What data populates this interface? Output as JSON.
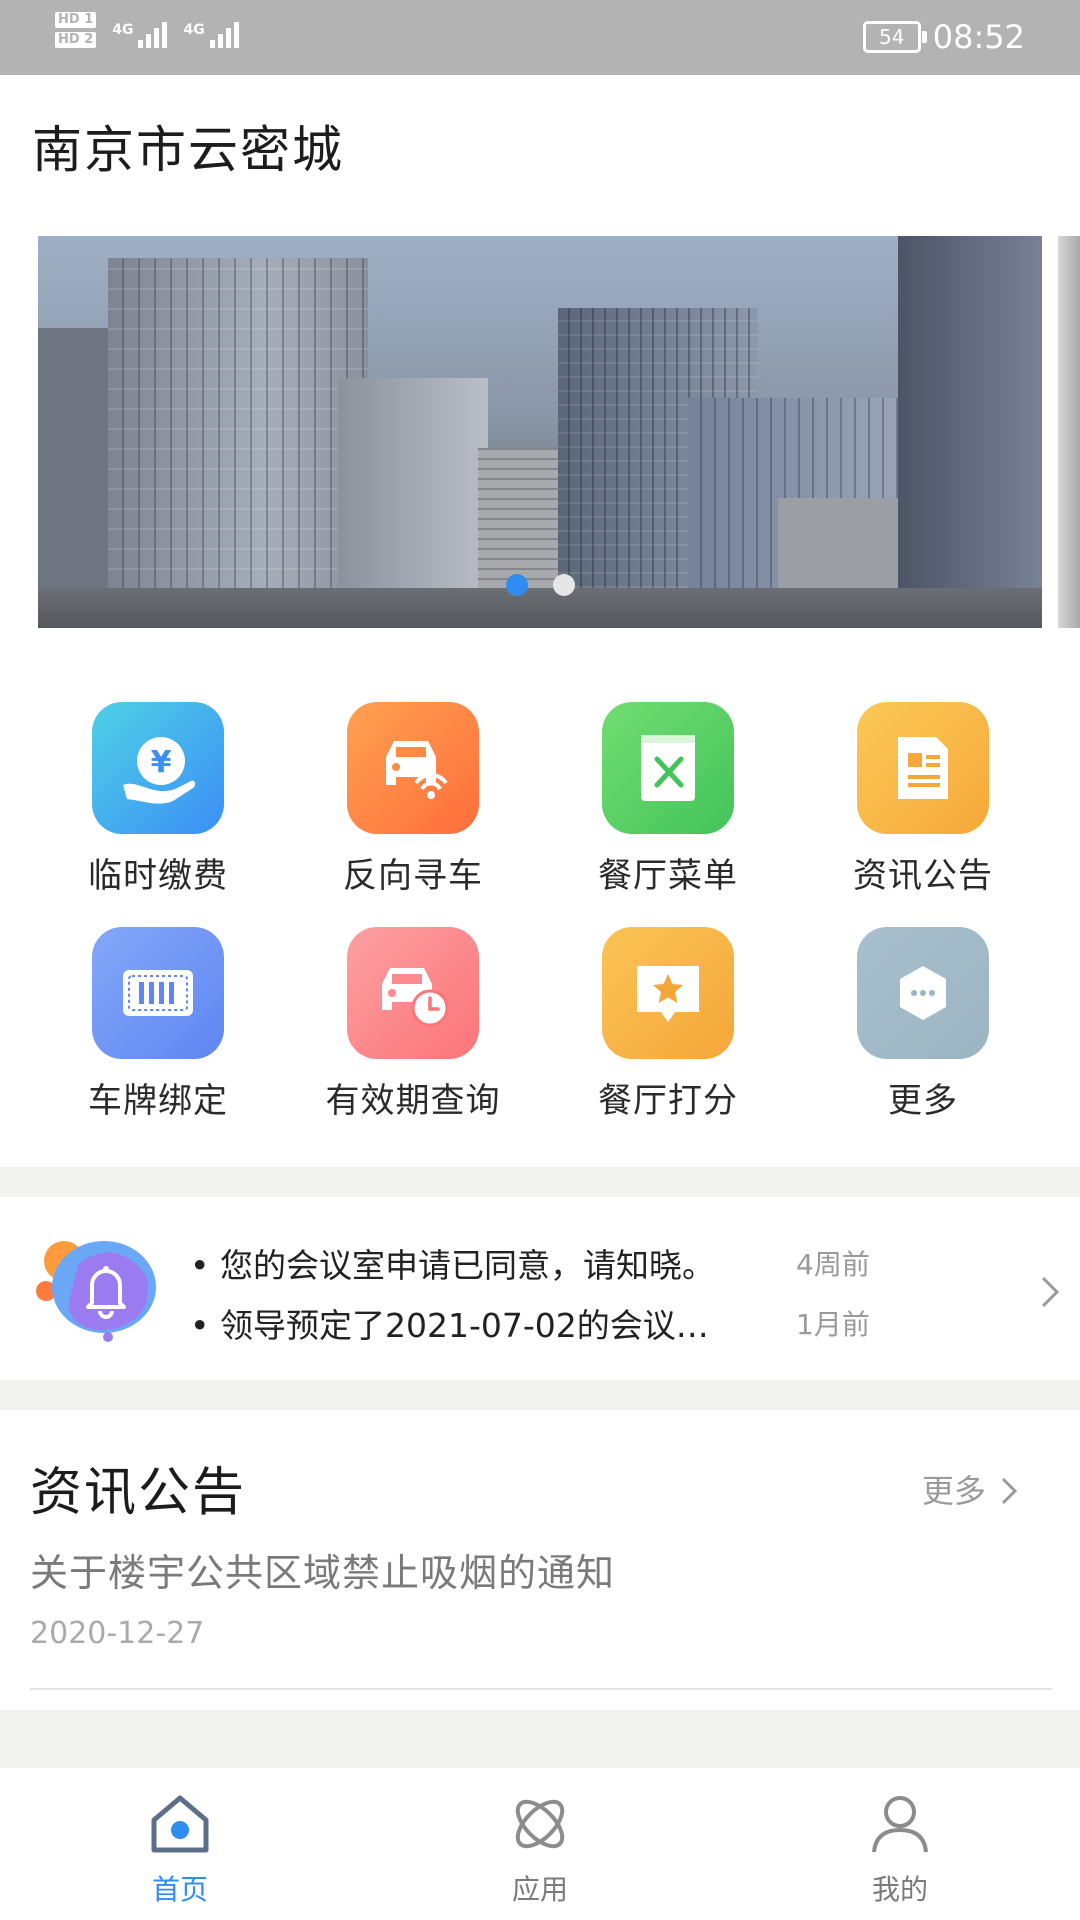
{
  "status_bar": {
    "hd1": "HD 1",
    "hd2": "HD 2",
    "net1": "4G",
    "net2": "4G",
    "battery": "54",
    "time": "08:52"
  },
  "header": {
    "title": "南京市云密城"
  },
  "banner": {
    "slide_count": 2,
    "active_slide": 1
  },
  "grid": {
    "items": [
      {
        "label": "临时缴费",
        "icon": "yuan-hand-icon",
        "colors": [
          "#4fd0e6",
          "#3b8ff5"
        ]
      },
      {
        "label": "反向寻车",
        "icon": "car-search-icon",
        "colors": [
          "#ffa150",
          "#ff6e3c"
        ]
      },
      {
        "label": "餐厅菜单",
        "icon": "menu-book-icon",
        "colors": [
          "#72dd72",
          "#43c45a"
        ]
      },
      {
        "label": "资讯公告",
        "icon": "news-doc-icon",
        "colors": [
          "#fbc856",
          "#f6a93a"
        ]
      },
      {
        "label": "车牌绑定",
        "icon": "license-plate-icon",
        "colors": [
          "#83a8f9",
          "#5f86f2"
        ]
      },
      {
        "label": "有效期查询",
        "icon": "car-clock-icon",
        "colors": [
          "#fda0a2",
          "#fc7478"
        ]
      },
      {
        "label": "餐厅打分",
        "icon": "star-rating-icon",
        "colors": [
          "#fbc455",
          "#f5a63a"
        ]
      },
      {
        "label": "更多",
        "icon": "more-icon",
        "colors": [
          "#a9bfcd",
          "#9bb4c3"
        ]
      }
    ]
  },
  "notices": [
    {
      "text": "您的会议室申请已同意，请知晓。",
      "time": "4周前"
    },
    {
      "text": "领导预定了2021-07-02的会议…",
      "time": "1月前"
    }
  ],
  "news": {
    "title": "资讯公告",
    "more_label": "更多",
    "headline": "关于楼宇公共区域禁止吸烟的通知",
    "date": "2020-12-27"
  },
  "tabbar": {
    "home": "首页",
    "apps": "应用",
    "mine": "我的"
  },
  "colors": {
    "accent": "#2f8cf0"
  }
}
